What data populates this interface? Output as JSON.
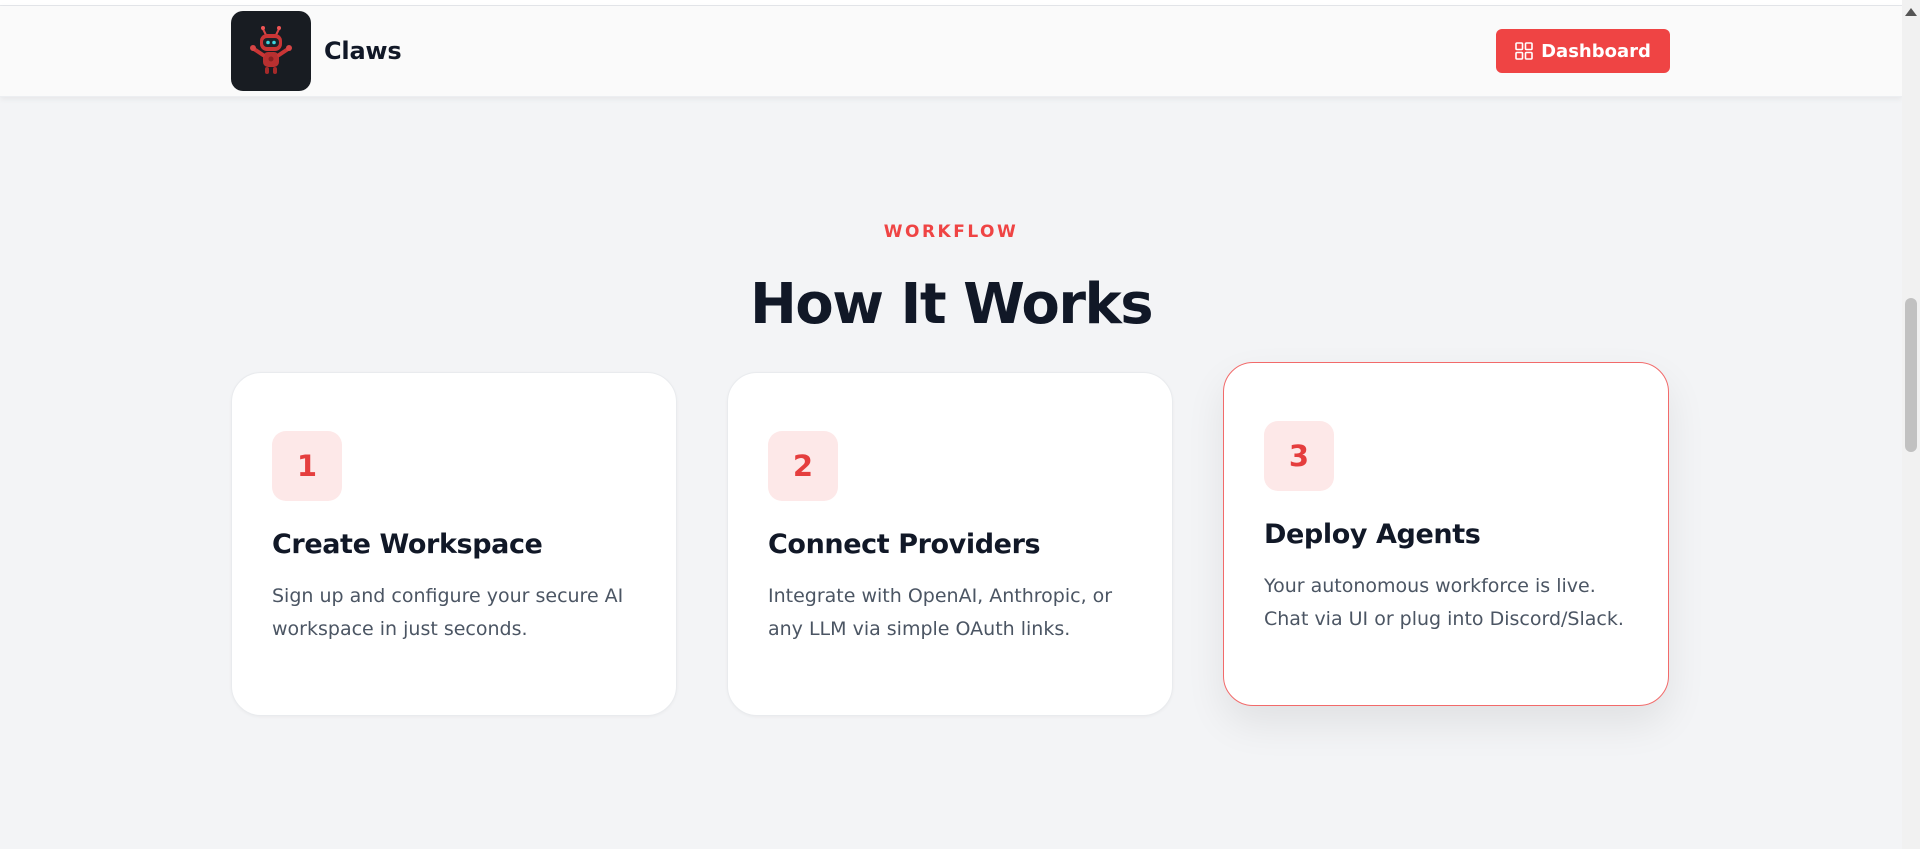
{
  "header": {
    "brand_name": "Claws",
    "logo_icon": "robot-icon",
    "dashboard_label": "Dashboard",
    "dashboard_icon": "grid-icon"
  },
  "section": {
    "eyebrow": "WORKFLOW",
    "title": "How It Works"
  },
  "steps": [
    {
      "number": "1",
      "title": "Create Workspace",
      "description": "Sign up and configure your secure AI workspace in just seconds."
    },
    {
      "number": "2",
      "title": "Connect Providers",
      "description": "Integrate with OpenAI, Anthropic, or any LLM via simple OAuth links."
    },
    {
      "number": "3",
      "title": "Deploy Agents",
      "description": "Your autonomous workforce is live. Chat via UI or plug into Discord/Slack."
    }
  ],
  "colors": {
    "accent": "#ef4444",
    "heading": "#111827",
    "body_text": "#4b5563",
    "badge_bg": "#fde8e8",
    "page_bg": "#f3f4f6"
  }
}
